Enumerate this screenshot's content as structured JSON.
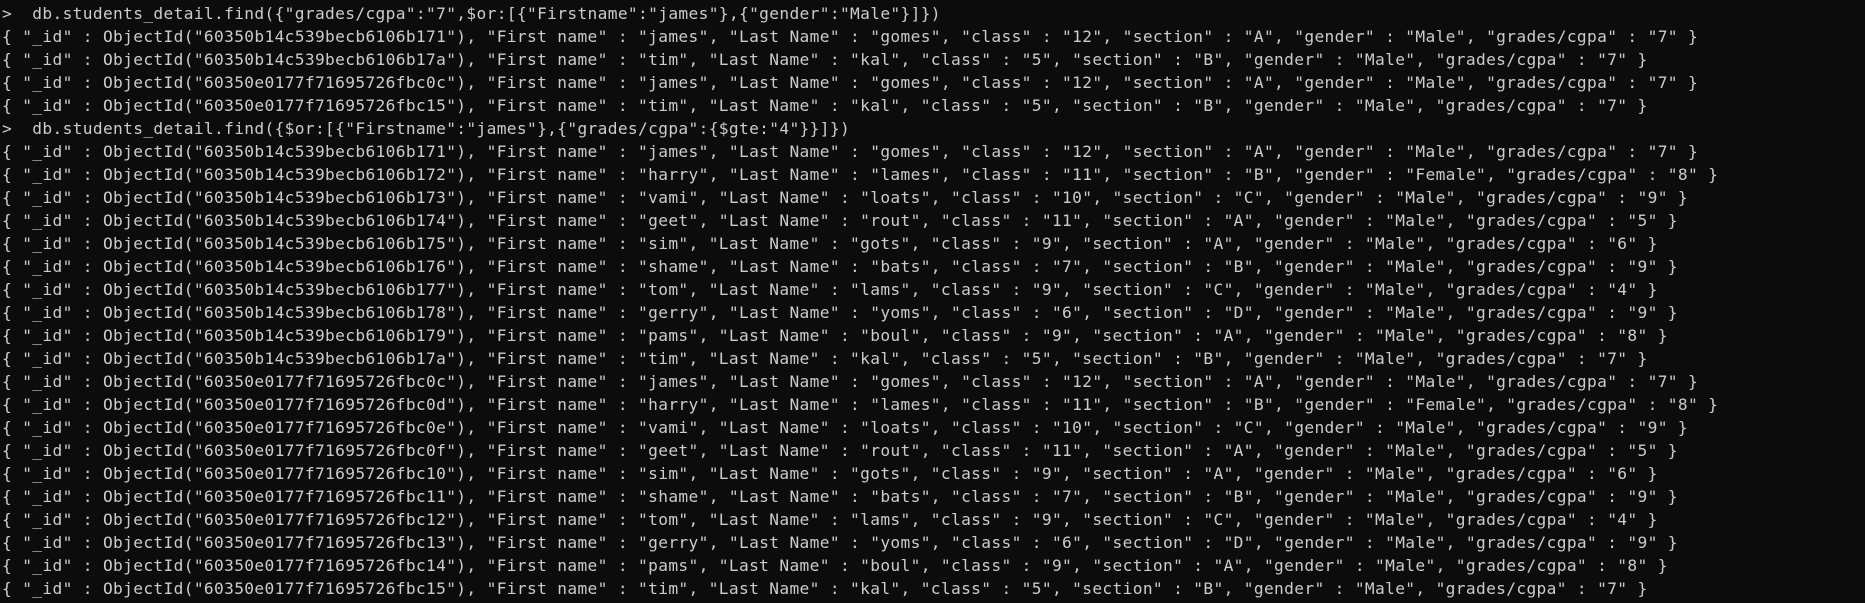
{
  "terminal": {
    "colors": {
      "background": "#0c0c0c",
      "foreground": "#cccccc"
    },
    "lines": [
      {
        "type": "command",
        "text": ">  db.students_detail.find({\"grades/cgpa\":\"7\",$or:[{\"Firstname\":\"james\"},{\"gender\":\"Male\"}]})"
      },
      {
        "type": "output",
        "text": "{ \"_id\" : ObjectId(\"60350b14c539becb6106b171\"), \"First name\" : \"james\", \"Last Name\" : \"gomes\", \"class\" : \"12\", \"section\" : \"A\", \"gender\" : \"Male\", \"grades/cgpa\" : \"7\" }"
      },
      {
        "type": "output",
        "text": "{ \"_id\" : ObjectId(\"60350b14c539becb6106b17a\"), \"First name\" : \"tim\", \"Last Name\" : \"kal\", \"class\" : \"5\", \"section\" : \"B\", \"gender\" : \"Male\", \"grades/cgpa\" : \"7\" }"
      },
      {
        "type": "output",
        "text": "{ \"_id\" : ObjectId(\"60350e0177f71695726fbc0c\"), \"First name\" : \"james\", \"Last Name\" : \"gomes\", \"class\" : \"12\", \"section\" : \"A\", \"gender\" : \"Male\", \"grades/cgpa\" : \"7\" }"
      },
      {
        "type": "output",
        "text": "{ \"_id\" : ObjectId(\"60350e0177f71695726fbc15\"), \"First name\" : \"tim\", \"Last Name\" : \"kal\", \"class\" : \"5\", \"section\" : \"B\", \"gender\" : \"Male\", \"grades/cgpa\" : \"7\" }"
      },
      {
        "type": "command",
        "text": ">  db.students_detail.find({$or:[{\"Firstname\":\"james\"},{\"grades/cgpa\":{$gte:\"4\"}}]})"
      },
      {
        "type": "output",
        "text": "{ \"_id\" : ObjectId(\"60350b14c539becb6106b171\"), \"First name\" : \"james\", \"Last Name\" : \"gomes\", \"class\" : \"12\", \"section\" : \"A\", \"gender\" : \"Male\", \"grades/cgpa\" : \"7\" }"
      },
      {
        "type": "output",
        "text": "{ \"_id\" : ObjectId(\"60350b14c539becb6106b172\"), \"First name\" : \"harry\", \"Last Name\" : \"lames\", \"class\" : \"11\", \"section\" : \"B\", \"gender\" : \"Female\", \"grades/cgpa\" : \"8\" }"
      },
      {
        "type": "output",
        "text": "{ \"_id\" : ObjectId(\"60350b14c539becb6106b173\"), \"First name\" : \"vami\", \"Last Name\" : \"loats\", \"class\" : \"10\", \"section\" : \"C\", \"gender\" : \"Male\", \"grades/cgpa\" : \"9\" }"
      },
      {
        "type": "output",
        "text": "{ \"_id\" : ObjectId(\"60350b14c539becb6106b174\"), \"First name\" : \"geet\", \"Last Name\" : \"rout\", \"class\" : \"11\", \"section\" : \"A\", \"gender\" : \"Male\", \"grades/cgpa\" : \"5\" }"
      },
      {
        "type": "output",
        "text": "{ \"_id\" : ObjectId(\"60350b14c539becb6106b175\"), \"First name\" : \"sim\", \"Last Name\" : \"gots\", \"class\" : \"9\", \"section\" : \"A\", \"gender\" : \"Male\", \"grades/cgpa\" : \"6\" }"
      },
      {
        "type": "output",
        "text": "{ \"_id\" : ObjectId(\"60350b14c539becb6106b176\"), \"First name\" : \"shame\", \"Last Name\" : \"bats\", \"class\" : \"7\", \"section\" : \"B\", \"gender\" : \"Male\", \"grades/cgpa\" : \"9\" }"
      },
      {
        "type": "output",
        "text": "{ \"_id\" : ObjectId(\"60350b14c539becb6106b177\"), \"First name\" : \"tom\", \"Last Name\" : \"lams\", \"class\" : \"9\", \"section\" : \"C\", \"gender\" : \"Male\", \"grades/cgpa\" : \"4\" }"
      },
      {
        "type": "output",
        "text": "{ \"_id\" : ObjectId(\"60350b14c539becb6106b178\"), \"First name\" : \"gerry\", \"Last Name\" : \"yoms\", \"class\" : \"6\", \"section\" : \"D\", \"gender\" : \"Male\", \"grades/cgpa\" : \"9\" }"
      },
      {
        "type": "output",
        "text": "{ \"_id\" : ObjectId(\"60350b14c539becb6106b179\"), \"First name\" : \"pams\", \"Last Name\" : \"boul\", \"class\" : \"9\", \"section\" : \"A\", \"gender\" : \"Male\", \"grades/cgpa\" : \"8\" }"
      },
      {
        "type": "output",
        "text": "{ \"_id\" : ObjectId(\"60350b14c539becb6106b17a\"), \"First name\" : \"tim\", \"Last Name\" : \"kal\", \"class\" : \"5\", \"section\" : \"B\", \"gender\" : \"Male\", \"grades/cgpa\" : \"7\" }"
      },
      {
        "type": "output",
        "text": "{ \"_id\" : ObjectId(\"60350e0177f71695726fbc0c\"), \"First name\" : \"james\", \"Last Name\" : \"gomes\", \"class\" : \"12\", \"section\" : \"A\", \"gender\" : \"Male\", \"grades/cgpa\" : \"7\" }"
      },
      {
        "type": "output",
        "text": "{ \"_id\" : ObjectId(\"60350e0177f71695726fbc0d\"), \"First name\" : \"harry\", \"Last Name\" : \"lames\", \"class\" : \"11\", \"section\" : \"B\", \"gender\" : \"Female\", \"grades/cgpa\" : \"8\" }"
      },
      {
        "type": "output",
        "text": "{ \"_id\" : ObjectId(\"60350e0177f71695726fbc0e\"), \"First name\" : \"vami\", \"Last Name\" : \"loats\", \"class\" : \"10\", \"section\" : \"C\", \"gender\" : \"Male\", \"grades/cgpa\" : \"9\" }"
      },
      {
        "type": "output",
        "text": "{ \"_id\" : ObjectId(\"60350e0177f71695726fbc0f\"), \"First name\" : \"geet\", \"Last Name\" : \"rout\", \"class\" : \"11\", \"section\" : \"A\", \"gender\" : \"Male\", \"grades/cgpa\" : \"5\" }"
      },
      {
        "type": "output",
        "text": "{ \"_id\" : ObjectId(\"60350e0177f71695726fbc10\"), \"First name\" : \"sim\", \"Last Name\" : \"gots\", \"class\" : \"9\", \"section\" : \"A\", \"gender\" : \"Male\", \"grades/cgpa\" : \"6\" }"
      },
      {
        "type": "output",
        "text": "{ \"_id\" : ObjectId(\"60350e0177f71695726fbc11\"), \"First name\" : \"shame\", \"Last Name\" : \"bats\", \"class\" : \"7\", \"section\" : \"B\", \"gender\" : \"Male\", \"grades/cgpa\" : \"9\" }"
      },
      {
        "type": "output",
        "text": "{ \"_id\" : ObjectId(\"60350e0177f71695726fbc12\"), \"First name\" : \"tom\", \"Last Name\" : \"lams\", \"class\" : \"9\", \"section\" : \"C\", \"gender\" : \"Male\", \"grades/cgpa\" : \"4\" }"
      },
      {
        "type": "output",
        "text": "{ \"_id\" : ObjectId(\"60350e0177f71695726fbc13\"), \"First name\" : \"gerry\", \"Last Name\" : \"yoms\", \"class\" : \"6\", \"section\" : \"D\", \"gender\" : \"Male\", \"grades/cgpa\" : \"9\" }"
      },
      {
        "type": "output",
        "text": "{ \"_id\" : ObjectId(\"60350e0177f71695726fbc14\"), \"First name\" : \"pams\", \"Last Name\" : \"boul\", \"class\" : \"9\", \"section\" : \"A\", \"gender\" : \"Male\", \"grades/cgpa\" : \"8\" }"
      },
      {
        "type": "output",
        "text": "{ \"_id\" : ObjectId(\"60350e0177f71695726fbc15\"), \"First name\" : \"tim\", \"Last Name\" : \"kal\", \"class\" : \"5\", \"section\" : \"B\", \"gender\" : \"Male\", \"grades/cgpa\" : \"7\" }"
      }
    ]
  }
}
